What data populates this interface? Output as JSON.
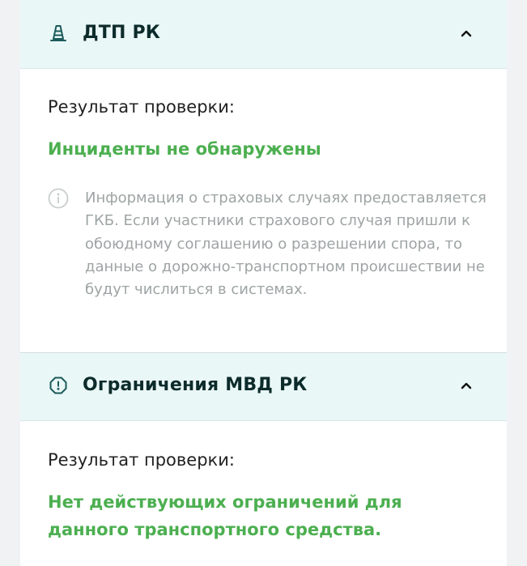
{
  "sections": [
    {
      "title": "ДТП РК",
      "icon": "traffic-cone-icon",
      "result_label": "Результат проверки:",
      "result_value": "Инциденты не обнаружены",
      "info_icon": "info-icon",
      "info_text": "Информация о страховых случаях предоставляется ГКБ. Если участники страхового случая пришли к обоюдному соглашению о разрешении спора, то данные о дорожно-транспортном происшествии не будут числиться в системах.",
      "expanded": true
    },
    {
      "title": "Ограничения МВД РК",
      "icon": "alert-octagon-icon",
      "result_label": "Результат проверки:",
      "result_value": "Нет действующих ограничений для данного транспортного средства.",
      "expanded": true
    }
  ],
  "colors": {
    "header_background": "#eaf7f7",
    "title_text": "#0d2b2b",
    "icon": "#1c5a5a",
    "success_green": "#4caf50",
    "muted_text": "#9ea4a4",
    "page_background": "#f1f2f4"
  }
}
